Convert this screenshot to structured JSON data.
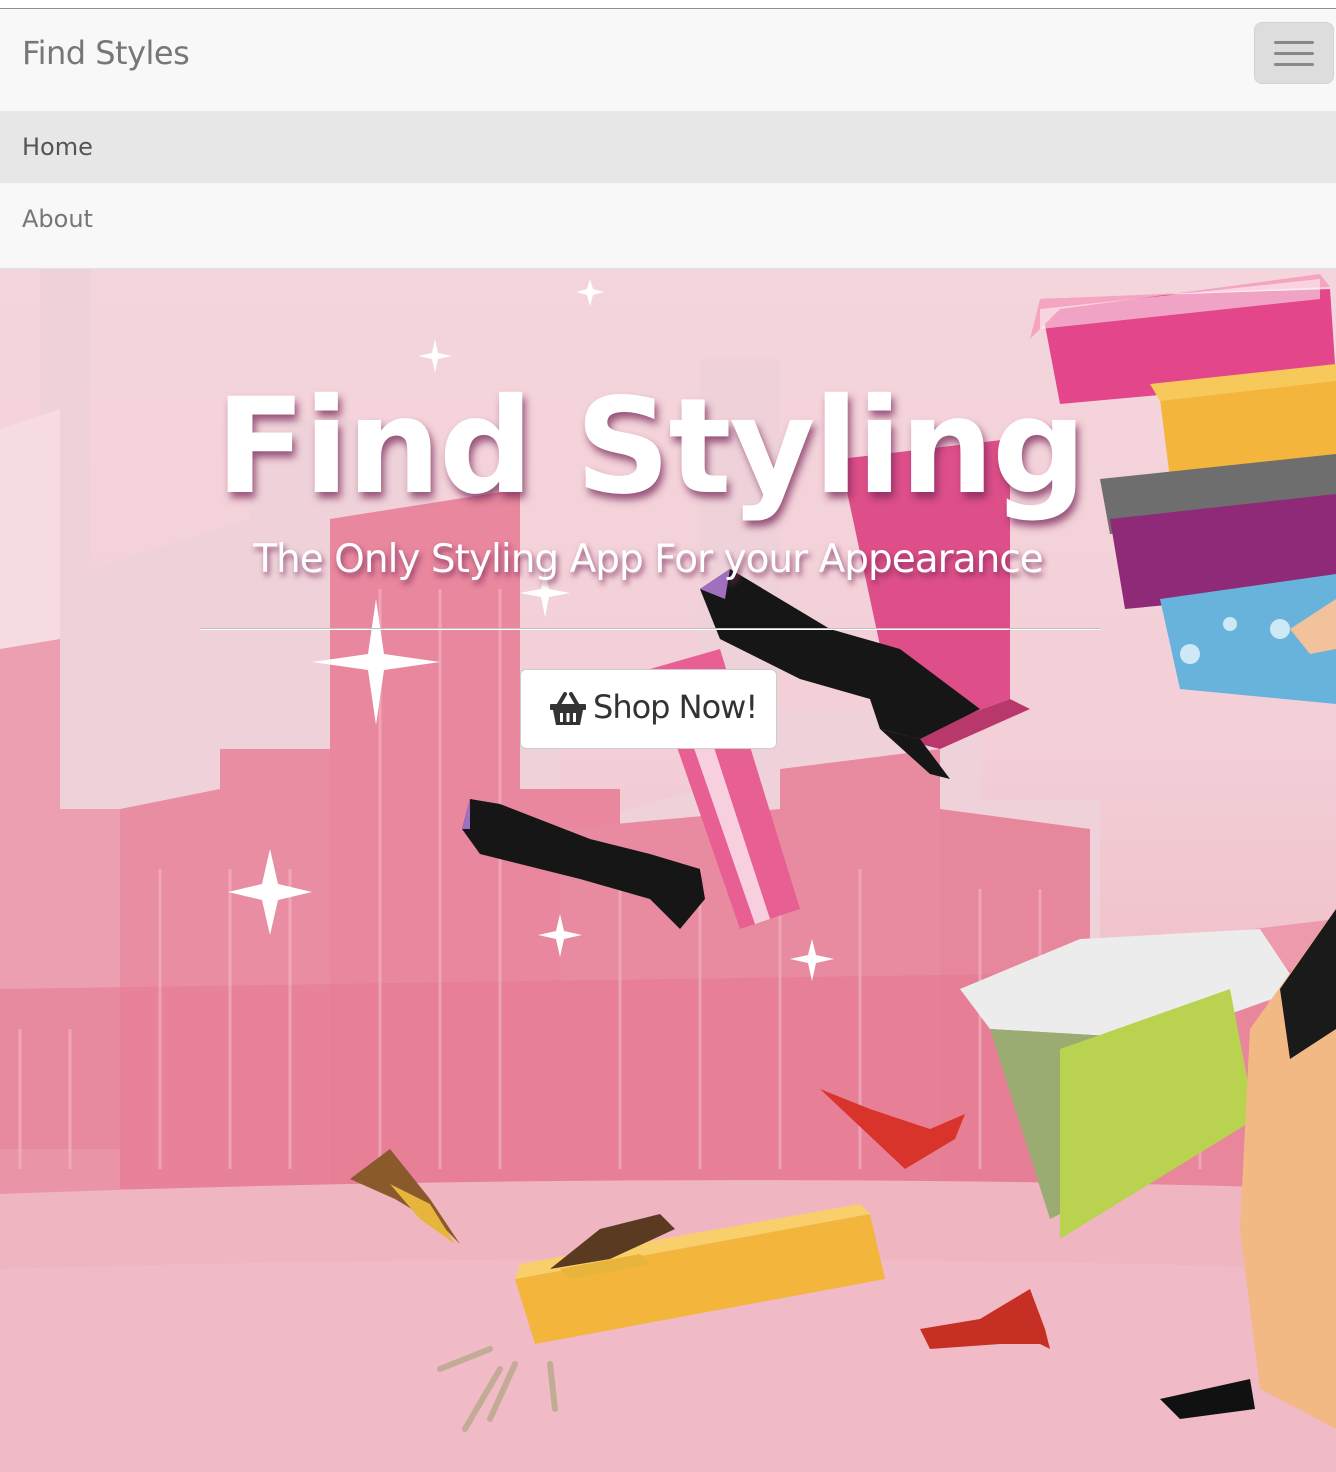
{
  "navbar": {
    "brand": "Find Styles",
    "toggle_icon": "hamburger-icon"
  },
  "menu": {
    "items": [
      {
        "label": "Home",
        "active": true
      },
      {
        "label": "About",
        "active": false
      }
    ]
  },
  "hero": {
    "title": "Find Styling",
    "subtitle": "The Only Styling App For your Appearance",
    "button_label": "Shop Now!",
    "button_icon": "shopping-basket-icon"
  },
  "colors": {
    "navbar_bg": "#f8f8f8",
    "active_item_bg": "#e7e7e7",
    "hero_pink": "#f3cfd7",
    "building_pink": "#e8788f"
  }
}
